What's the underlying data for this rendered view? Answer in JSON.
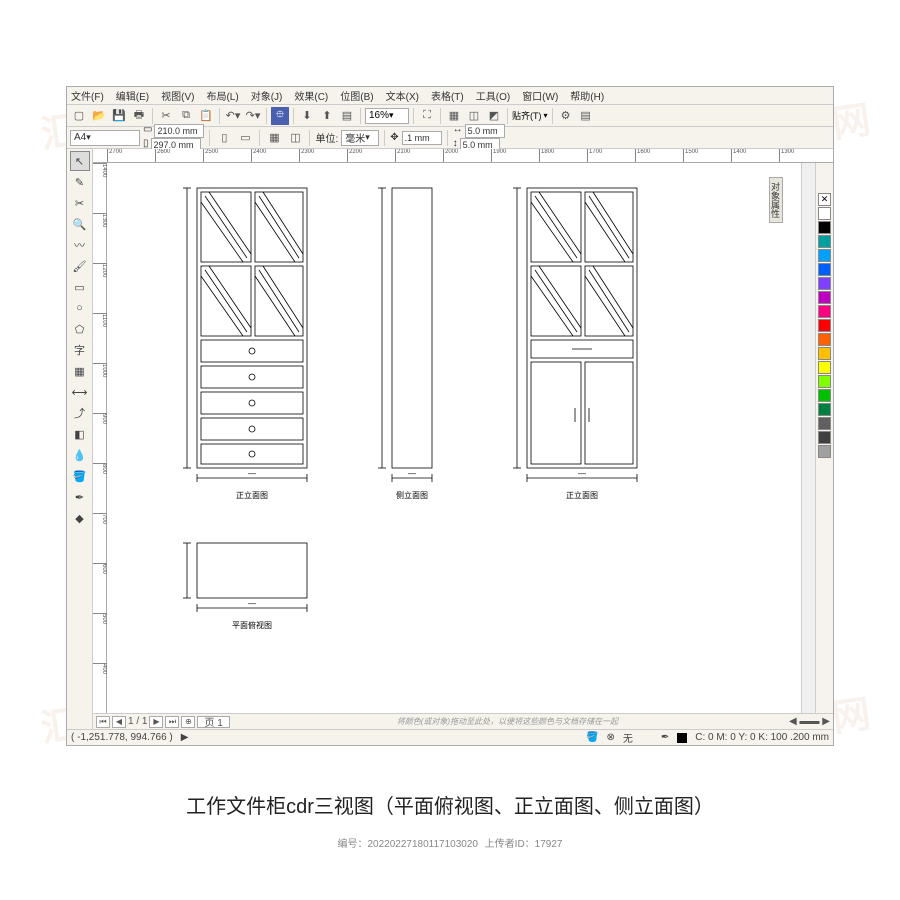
{
  "menu": {
    "file": "文件(F)",
    "edit": "编辑(E)",
    "view": "视图(V)",
    "layout": "布局(L)",
    "object": "对象(J)",
    "effects": "效果(C)",
    "bitmap": "位图(B)",
    "text": "文本(X)",
    "table": "表格(T)",
    "tools": "工具(O)",
    "window": "窗口(W)",
    "help": "帮助(H)"
  },
  "toolbar": {
    "zoom": "16%",
    "paste": "贴齐(T)"
  },
  "prop": {
    "paper": "A4",
    "w": "210.0 mm",
    "h": "297.0 mm",
    "unit_label": "单位:",
    "unit": "毫米",
    "nudge": ".1 mm",
    "dup_x": "5.0 mm",
    "dup_y": "5.0 mm"
  },
  "ruler": {
    "h": [
      "2700",
      "2600",
      "2500",
      "2400",
      "2300",
      "2200",
      "2100",
      "2000",
      "1900",
      "1800",
      "1700",
      "1600",
      "1500",
      "1400",
      "1300"
    ],
    "v": [
      "1400",
      "1300",
      "1200",
      "1100",
      "1000",
      "900",
      "800",
      "700",
      "600",
      "500",
      "400"
    ]
  },
  "views": {
    "front": "正立面图",
    "side": "侧立面图",
    "front2": "正立面图",
    "top": "平面俯视图"
  },
  "pagenav": {
    "pages": "1 / 1",
    "tab": "页 1"
  },
  "hint": "将颜色(或对象)拖动至此处，以便将这些颜色与文档存储在一起",
  "status": {
    "coords": "( -1,251.778, 994.766 )",
    "fill": "无",
    "cmyk": "C: 0 M: 0 Y: 0 K: 100  .200 mm"
  },
  "docker": "对象属性",
  "palette": [
    "#ffffff",
    "#000000",
    "#00a0a0",
    "#00a0ff",
    "#0060ff",
    "#8040ff",
    "#c000c0",
    "#ff0080",
    "#ff0000",
    "#ff6000",
    "#ffc000",
    "#ffff00",
    "#80ff00",
    "#00c000",
    "#008040",
    "#606060",
    "#404040",
    "#a0a0a0"
  ],
  "caption": "工作文件柜cdr三视图（平面俯视图、正立面图、侧立面图）",
  "meta_id": "编号：20220227180117103020",
  "uploader": "上传者ID：17927",
  "watermark": "汇图网"
}
